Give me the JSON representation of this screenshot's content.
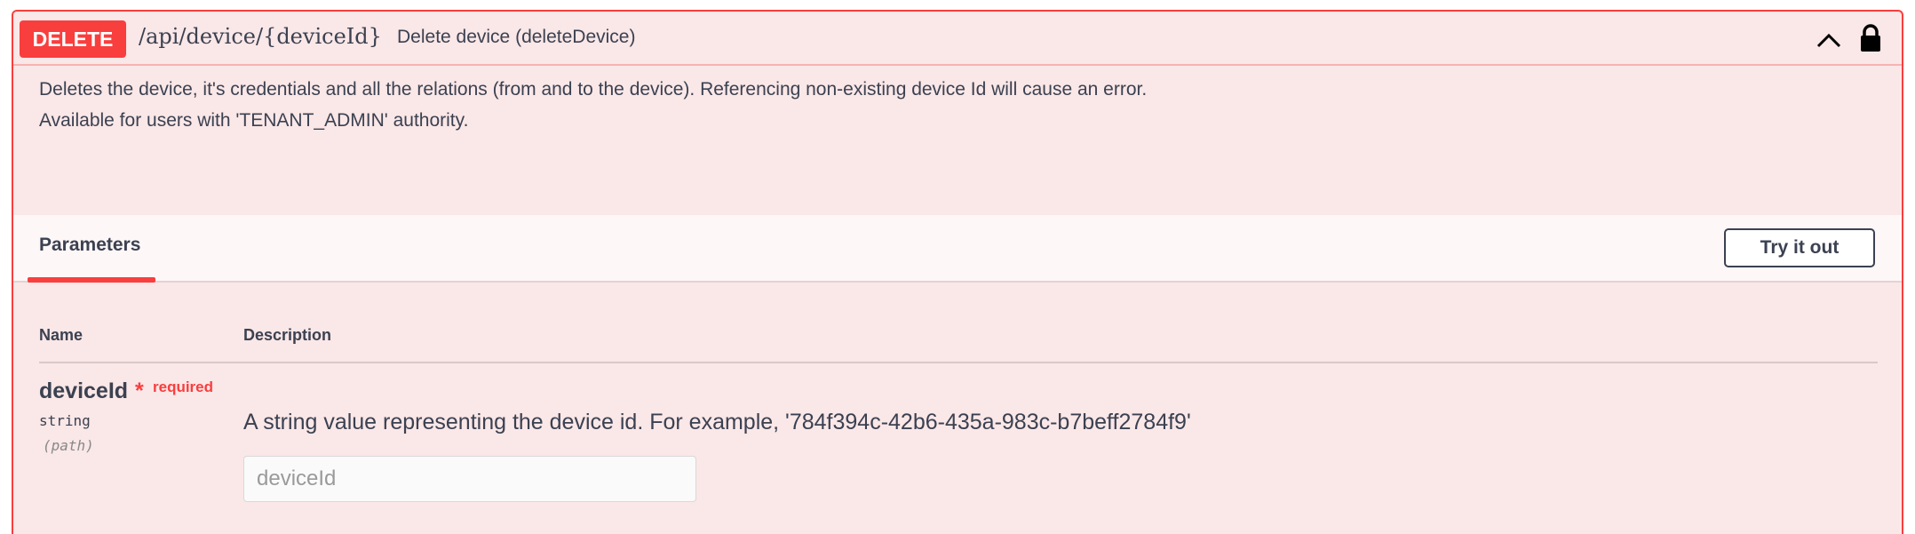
{
  "operation": {
    "method": "DELETE",
    "path": "/api/device/{deviceId}",
    "summary": "Delete device (deleteDevice)",
    "description_line1": "Deletes the device, it's credentials and all the relations (from and to the device). Referencing non-existing device Id will cause an error.",
    "description_line2": "Available for users with 'TENANT_ADMIN' authority."
  },
  "parameters": {
    "tab_label": "Parameters",
    "try_button": "Try it out",
    "col_name": "Name",
    "col_description": "Description",
    "items": [
      {
        "name": "deviceId",
        "required_star": "*",
        "required_label": "required",
        "type": "string",
        "in": "(path)",
        "description": "A string value representing the device id. For example, '784f394c-42b6-435a-983c-b7beff2784f9'",
        "placeholder": "deviceId",
        "value": ""
      }
    ]
  },
  "icons": {
    "collapse": "chevron-up-icon",
    "auth": "lock-icon"
  },
  "colors": {
    "accent": "#f93e3e",
    "background": "#fae7e7",
    "text": "#3b4151"
  }
}
